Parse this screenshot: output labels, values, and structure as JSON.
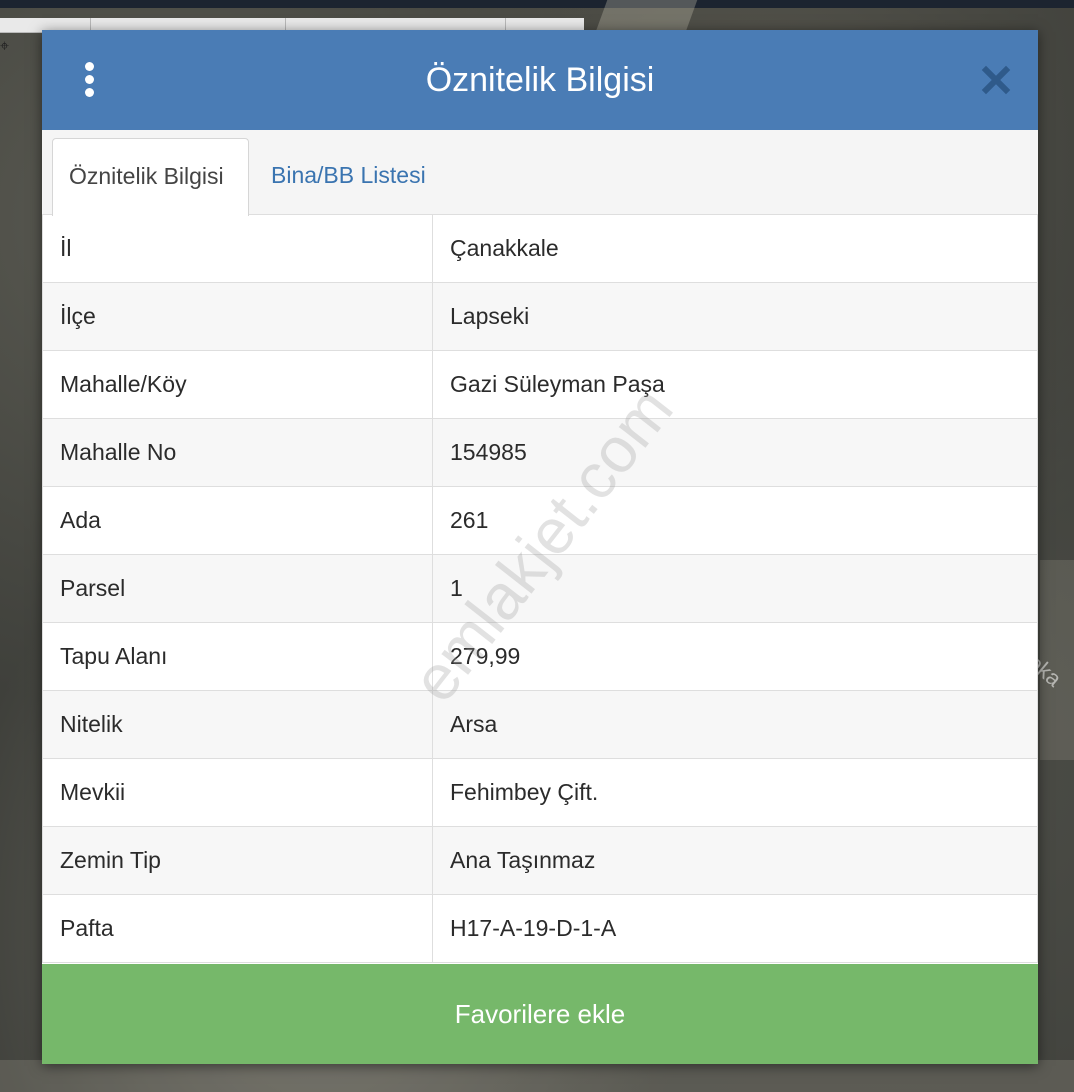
{
  "modal": {
    "title": "Öznitelik Bilgisi",
    "menu_icon": "vertical-ellipsis-icon",
    "close_icon": "close-icon"
  },
  "tabs": [
    {
      "label": "Öznitelik Bilgisi",
      "active": true
    },
    {
      "label": "Bina/BB Listesi",
      "active": false
    }
  ],
  "attributes": [
    {
      "key": "İl",
      "value": "Çanakkale"
    },
    {
      "key": "İlçe",
      "value": "Lapseki"
    },
    {
      "key": "Mahalle/Köy",
      "value": "Gazi Süleyman Paşa"
    },
    {
      "key": "Mahalle No",
      "value": "154985"
    },
    {
      "key": "Ada",
      "value": "261"
    },
    {
      "key": "Parsel",
      "value": "1"
    },
    {
      "key": "Tapu Alanı",
      "value": "279,99"
    },
    {
      "key": "Nitelik",
      "value": "Arsa"
    },
    {
      "key": "Mevkii",
      "value": "Fehimbey Çift."
    },
    {
      "key": "Zemin Tip",
      "value": "Ana Taşınmaz"
    },
    {
      "key": "Pafta",
      "value": "H17-A-19-D-1-A"
    }
  ],
  "favorite_button_label": "Favorilere ekle",
  "watermark": "emlakjet.com",
  "map": {
    "street_label_fragment": "Soka"
  },
  "colors": {
    "header": "#4a7cb5",
    "tab_link": "#3a74b0",
    "favorite_button": "#76b86a"
  }
}
